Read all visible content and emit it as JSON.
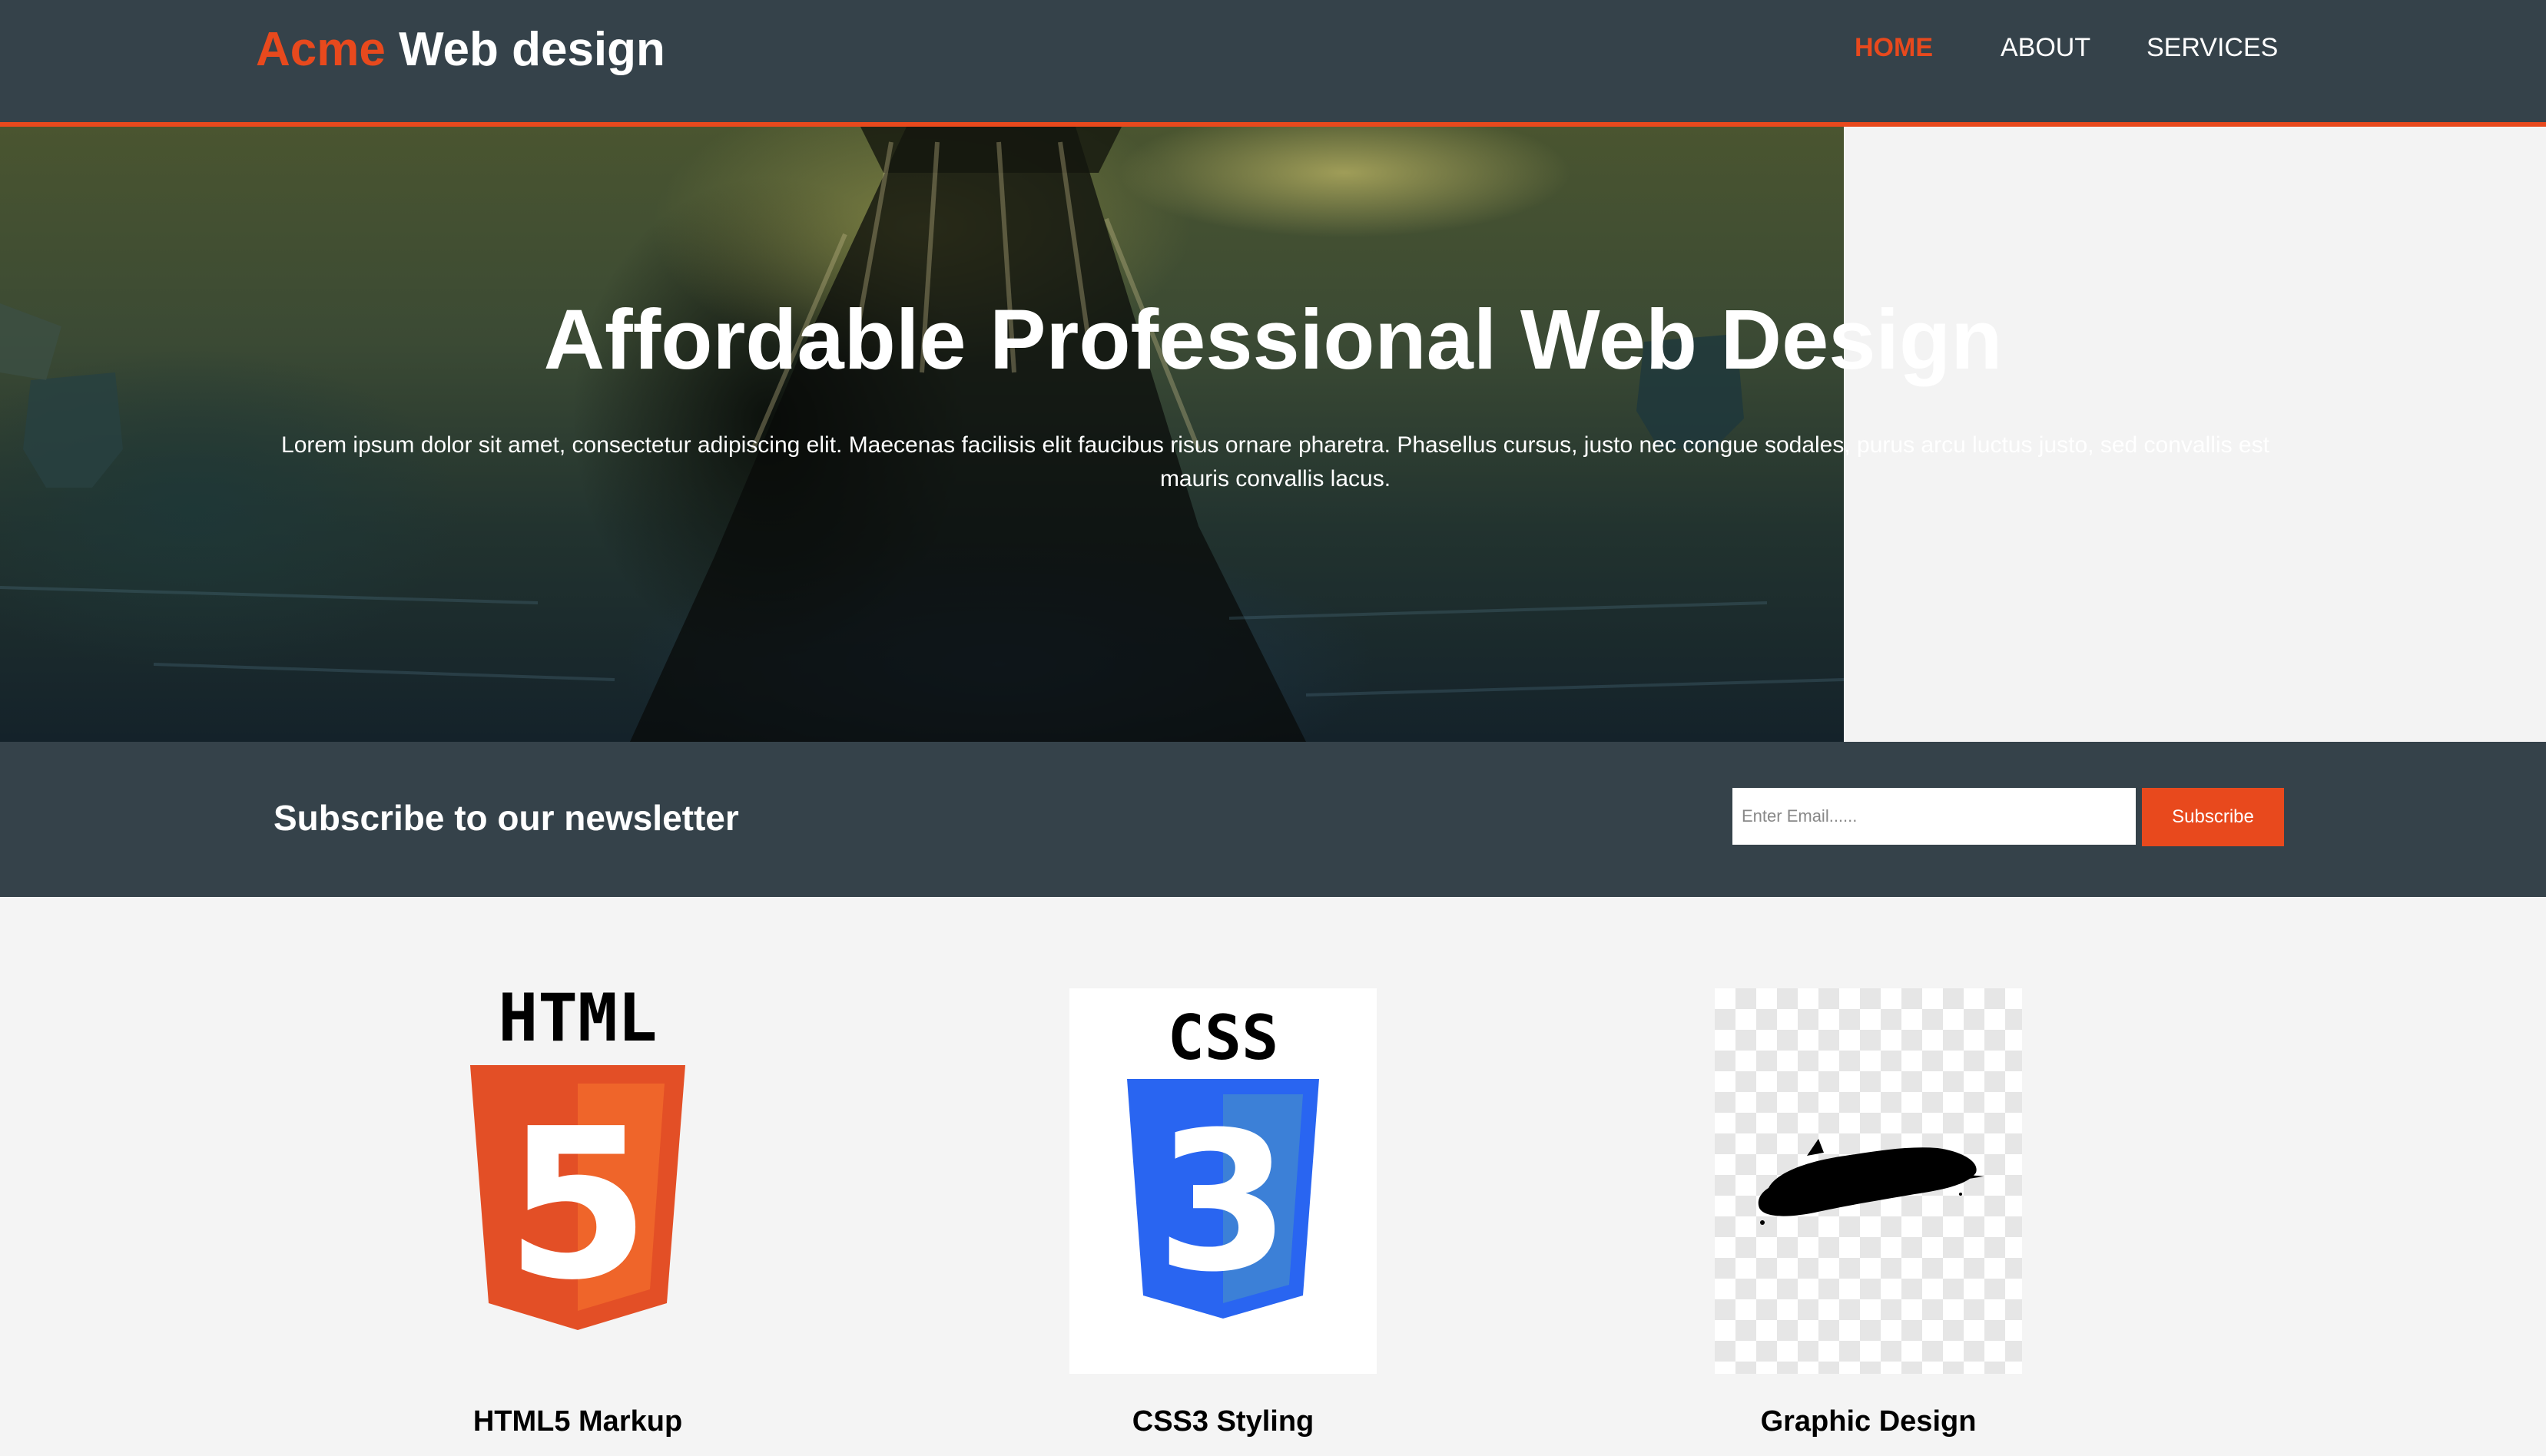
{
  "header": {
    "brand_highlight": "Acme",
    "brand_rest": "Web design",
    "nav": [
      {
        "label": "HOME",
        "active": true
      },
      {
        "label": "ABOUT",
        "active": false
      },
      {
        "label": "SERVICES",
        "active": false
      }
    ]
  },
  "showcase": {
    "title": "Affordable Professional Web Design",
    "text": "Lorem ipsum dolor sit amet, consectetur adipiscing elit. Maecenas facilisis elit faucibus risus ornare pharetra. Phasellus cursus, justo nec congue sodales, purus arcu luctus justo, sed convallis est mauris convallis lacus."
  },
  "newsletter": {
    "heading": "Subscribe to our newsletter",
    "email_placeholder": "Enter Email......",
    "email_value": "",
    "button_label": "Subscribe"
  },
  "boxes": [
    {
      "title": "HTML5 Markup",
      "icon": "html5-logo-icon",
      "logo_text": "HTML",
      "logo_number": "5"
    },
    {
      "title": "CSS3 Styling",
      "icon": "css3-logo-icon",
      "logo_text": "CSS",
      "logo_number": "3"
    },
    {
      "title": "Graphic Design",
      "icon": "brush-stroke-icon"
    }
  ],
  "colors": {
    "accent": "#e8491d",
    "header_bg": "#35424a",
    "page_bg": "#f4f4f4",
    "css_blue": "#2965f1"
  }
}
